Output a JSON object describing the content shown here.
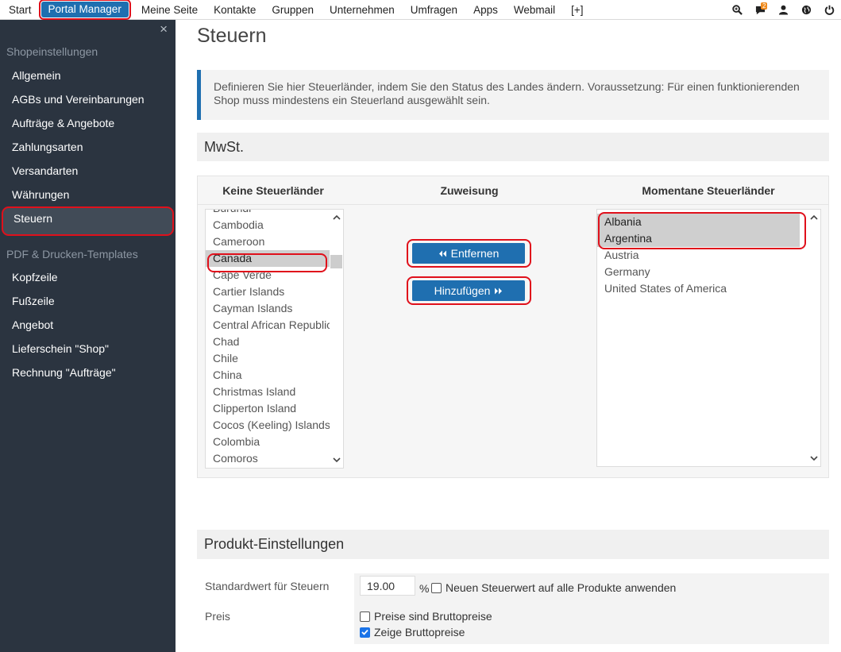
{
  "topnav": {
    "items": [
      "Start",
      "Portal Manager",
      "Meine Seite",
      "Kontakte",
      "Gruppen",
      "Unternehmen",
      "Umfragen",
      "Apps",
      "Webmail",
      "[+]"
    ],
    "active_index": 1,
    "icons": [
      "search-icon",
      "chat-icon",
      "user-icon",
      "globe-icon",
      "power-icon"
    ],
    "chat_badge": "2"
  },
  "sidebar": {
    "close_glyph": "×",
    "section1": "Shopeinstellungen",
    "items1": [
      "Allgemein",
      "AGBs und Vereinbarungen",
      "Aufträge & Angebote",
      "Zahlungsarten",
      "Versandarten",
      "Währungen",
      "Steuern"
    ],
    "section2": "PDF & Drucken-Templates",
    "items2": [
      "Kopfzeile",
      "Fußzeile",
      "Angebot",
      "Lieferschein \"Shop\"",
      "Rechnung \"Aufträge\""
    ]
  },
  "page": {
    "title": "Steuern",
    "info": "Definieren Sie hier Steuerländer, indem Sie den Status des Landes ändern. Voraussetzung: Für einen funktionierenden Shop muss mindestens ein Steuerland ausgewählt sein."
  },
  "mwst": {
    "heading": "MwSt.",
    "col_left": "Keine Steuerländer",
    "col_mid": "Zuweisung",
    "col_right": "Momentane Steuerländer",
    "left_list": [
      "Burundi",
      "Cambodia",
      "Cameroon",
      "Canada",
      "Cape Verde",
      "Cartier Islands",
      "Cayman Islands",
      "Central African Republic",
      "Chad",
      "Chile",
      "China",
      "Christmas Island",
      "Clipperton Island",
      "Cocos (Keeling) Islands",
      "Colombia",
      "Comoros"
    ],
    "left_selected": [
      "Canada"
    ],
    "right_list": [
      "Albania",
      "Argentina",
      "Austria",
      "Germany",
      "United States of America"
    ],
    "right_selected": [
      "Albania",
      "Argentina"
    ],
    "btn_remove": "Entfernen",
    "btn_add": "Hinzufügen"
  },
  "product": {
    "heading": "Produkt-Einstellungen",
    "tax_label": "Standardwert für Steuern",
    "tax_value": "19.00",
    "percent": "%",
    "apply_label": "Neuen Steuerwert auf alle Produkte anwenden",
    "apply_checked": false,
    "price_label": "Preis",
    "gross_label": "Preise sind Bruttopreise",
    "gross_checked": false,
    "show_gross_label": "Zeige Bruttopreise",
    "show_gross_checked": true
  },
  "colors": {
    "accent": "#1f6fb0",
    "sidebar_bg": "#2b3440",
    "highlight": "#e0101b"
  }
}
